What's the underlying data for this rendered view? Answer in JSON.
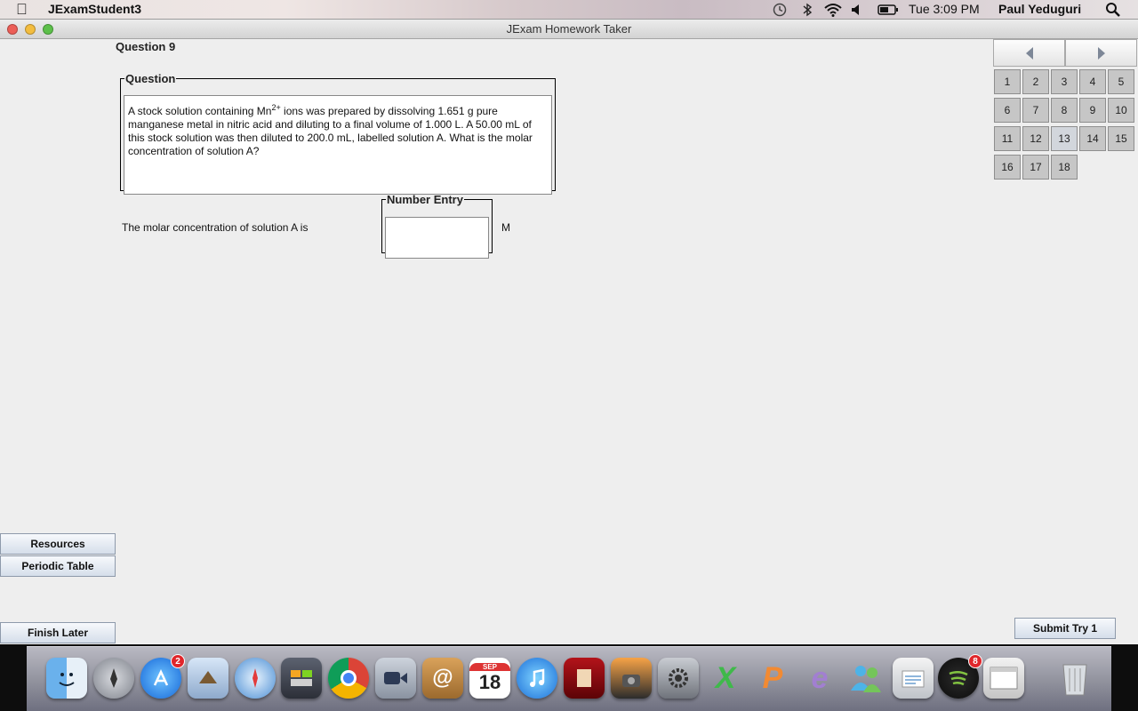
{
  "menubar": {
    "app_name": "JExamStudent3",
    "clock": "Tue 3:09 PM",
    "user": "Paul Yeduguri",
    "icons": [
      "apple-icon",
      "time-machine-icon",
      "bluetooth-icon",
      "wifi-icon",
      "volume-icon",
      "battery-icon",
      "spotlight-icon"
    ]
  },
  "window": {
    "title": "JExam Homework Taker"
  },
  "question": {
    "heading": "Question 9",
    "legend": "Question",
    "text_before": "A stock solution containing Mn",
    "superscript": "2+",
    "text_after": " ions was prepared by dissolving 1.651 g pure manganese metal in nitric acid and diluting to a final volume of 1.000 L. A 50.00 mL of this stock solution was then diluted to 200.0 mL, labelled solution A. What is the molar concentration of solution A?"
  },
  "answer": {
    "label": "The molar concentration of solution A is",
    "legend": "Number Entry",
    "value": "",
    "unit": "M"
  },
  "navigator": {
    "prev_icon": "left-arrow-icon",
    "next_icon": "right-arrow-icon",
    "numbers": [
      "1",
      "2",
      "3",
      "4",
      "5",
      "6",
      "7",
      "8",
      "9",
      "10",
      "11",
      "12",
      "13",
      "14",
      "15",
      "16",
      "17",
      "18"
    ],
    "current": "13"
  },
  "buttons": {
    "resources": "Resources",
    "periodic_table": "Periodic Table",
    "finish_later": "Finish Later",
    "submit": "Submit Try 1"
  },
  "dock": {
    "app_store_badge": "2",
    "calendar_month": "SEP",
    "calendar_day": "18",
    "spotify_badge": "8"
  },
  "colors": {
    "button_gradient_top": "#f7f9fc",
    "button_gradient_bottom": "#d5deea",
    "question_number_bg": "#c6c6c6",
    "badge_red": "#e0262b"
  }
}
